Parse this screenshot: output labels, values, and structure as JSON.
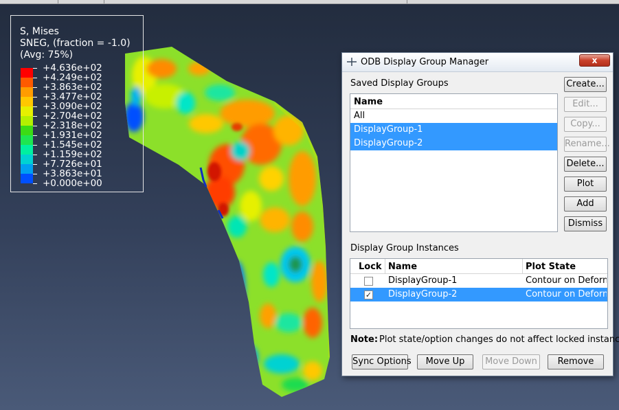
{
  "legend": {
    "line1": "S, Mises",
    "line2": "SNEG, (fraction = -1.0)",
    "line3": "(Avg: 75%)",
    "values": [
      "+4.636e+02",
      "+4.249e+02",
      "+3.863e+02",
      "+3.477e+02",
      "+3.090e+02",
      "+2.704e+02",
      "+2.318e+02",
      "+1.931e+02",
      "+1.545e+02",
      "+1.159e+02",
      "+7.726e+01",
      "+3.863e+01",
      "+0.000e+00"
    ],
    "colors": [
      "#ff0000",
      "#ff5a00",
      "#ff9c00",
      "#ffc800",
      "#e6f000",
      "#b4f000",
      "#3cdc14",
      "#1ee650",
      "#00f0a0",
      "#00d2d2",
      "#00a0f0",
      "#0050ff",
      "#0000ff"
    ]
  },
  "dialog": {
    "title": "ODB Display Group Manager",
    "close_label": "x",
    "saved_label": "Saved Display Groups",
    "saved_header": "Name",
    "saved_items": [
      {
        "name": "All",
        "selected": false
      },
      {
        "name": "DisplayGroup-1",
        "selected": true
      },
      {
        "name": "DisplayGroup-2",
        "selected": true
      }
    ],
    "side_buttons": {
      "create": "Create...",
      "edit": "Edit...",
      "copy": "Copy...",
      "rename": "Rename...",
      "delete": "Delete...",
      "plot": "Plot",
      "add": "Add",
      "dismiss": "Dismiss"
    },
    "instances_label": "Display Group Instances",
    "instance_headers": {
      "lock": "Lock",
      "name": "Name",
      "state": "Plot State"
    },
    "instances": [
      {
        "locked": false,
        "name": "DisplayGroup-1",
        "state": "Contour on Deformed Shape",
        "selected": false
      },
      {
        "locked": true,
        "name": "DisplayGroup-2",
        "state": "Contour on Deformed Shape",
        "selected": true
      }
    ],
    "note_label": "Note:",
    "note_text": "Plot state/option changes do not affect locked instances.",
    "bottom_buttons": {
      "sync": "Sync Options",
      "up": "Move Up",
      "down": "Move Down",
      "remove": "Remove"
    }
  }
}
